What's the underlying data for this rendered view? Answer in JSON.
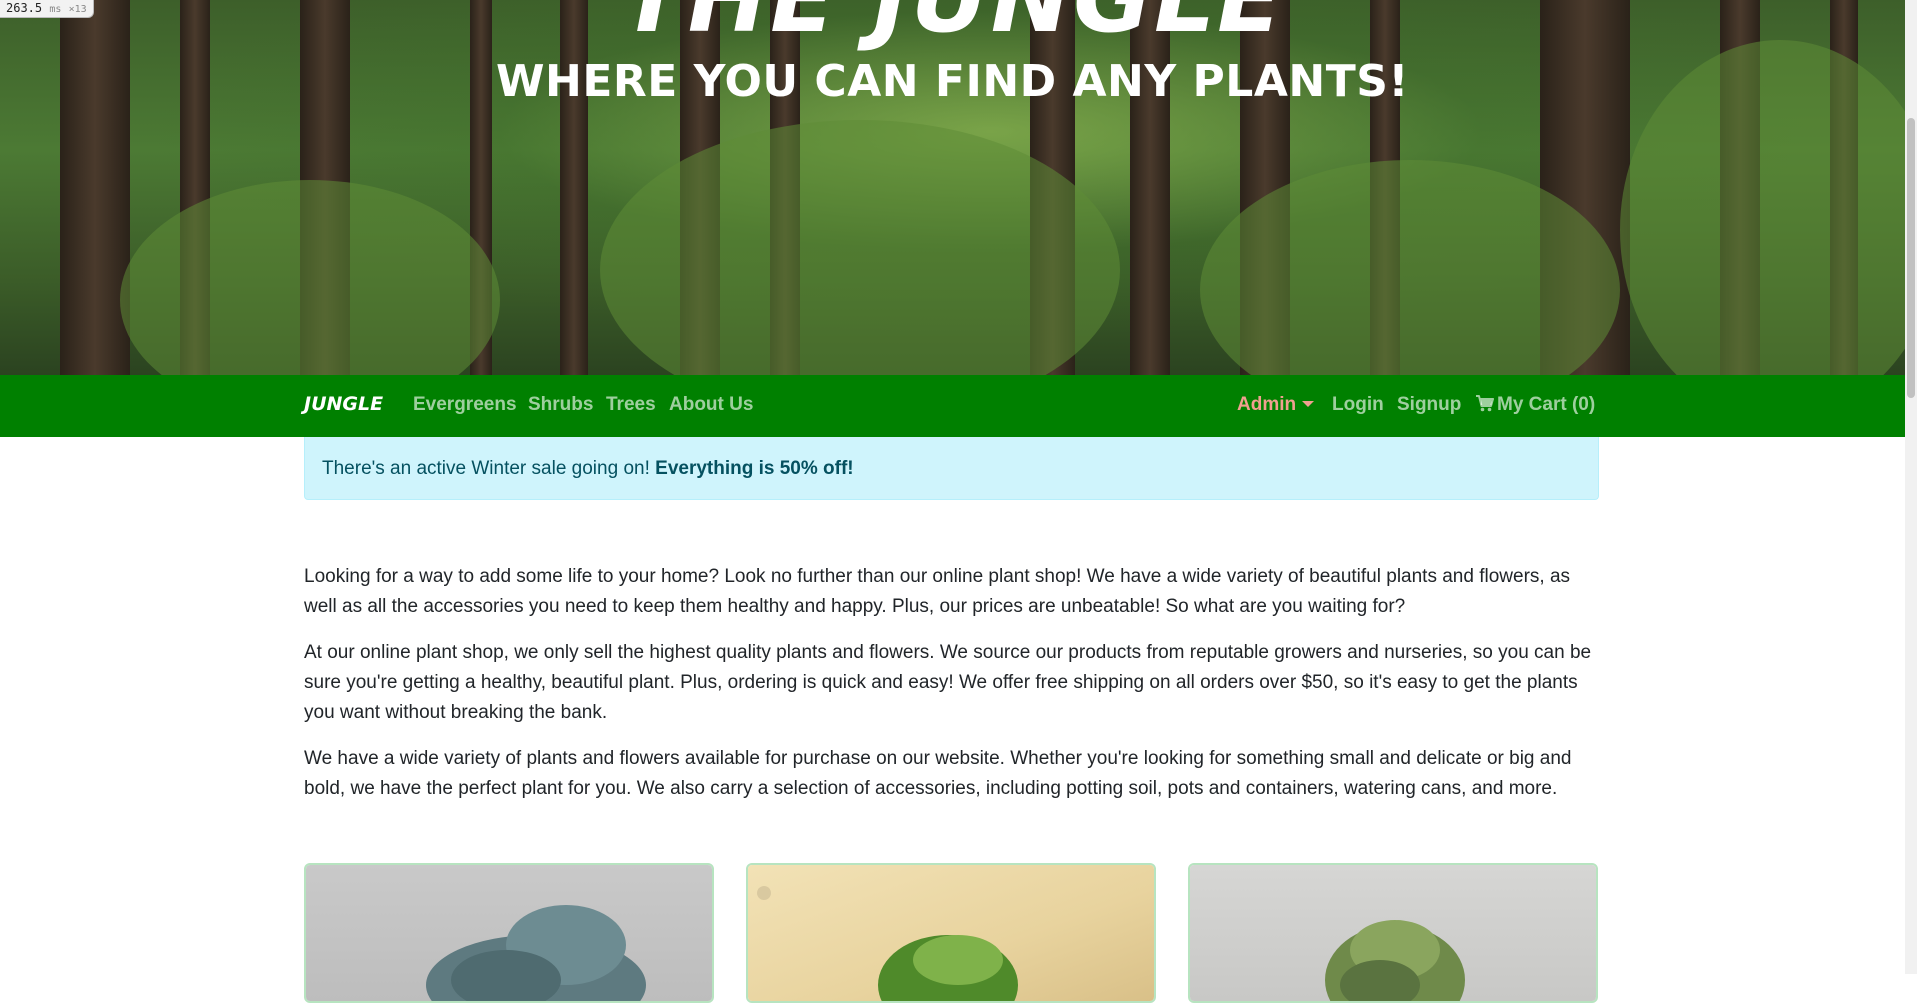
{
  "perf_overlay": {
    "value": "263.5",
    "unit": "ms",
    "count": "×13"
  },
  "hero": {
    "title": "THE JUNGLE",
    "subtitle": "WHERE YOU CAN FIND ANY PLANTS!"
  },
  "navbar": {
    "brand": "JUNGLE",
    "left_links": [
      "Evergreens",
      "Shrubs",
      "Trees",
      "About Us"
    ],
    "admin_label": "Admin",
    "login_label": "Login",
    "signup_label": "Signup",
    "cart_label": "My Cart (0)",
    "cart_icon": "shopping-cart-icon",
    "colors": {
      "background": "#008000",
      "admin": "#f0a090"
    }
  },
  "alert": {
    "text": "There's an active Winter sale going on! ",
    "emphasis": "Everything is 50% off!"
  },
  "content": {
    "paragraphs": [
      "Looking for a way to add some life to your home? Look no further than our online plant shop! We have a wide variety of beautiful plants and flowers, as well as all the accessories you need to keep them healthy and happy. Plus, our prices are unbeatable! So what are you waiting for?",
      "At our online plant shop, we only sell the highest quality plants and flowers. We source our products from reputable growers and nurseries, so you can be sure you're getting a healthy, beautiful plant. Plus, ordering is quick and easy! We offer free shipping on all orders over $50, so it's easy to get the plants you want without breaking the bank.",
      "We have a wide variety of plants and flowers available for purchase on our website. Whether you're looking for something small and delicate or big and bold, we have the perfect plant for you. We also carry a selection of accessories, including potting soil, pots and containers, watering cans, and more."
    ]
  }
}
